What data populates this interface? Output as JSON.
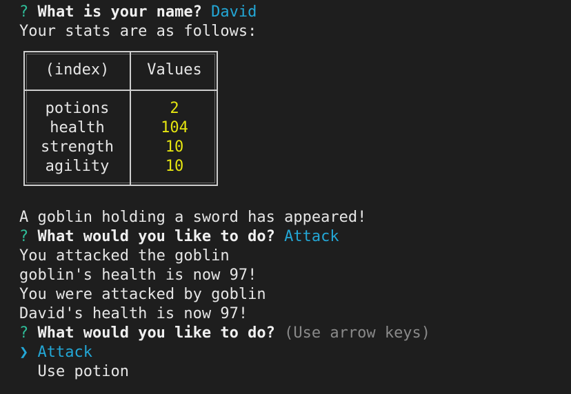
{
  "prompt_name": {
    "marker": "?",
    "question": "What is your name?",
    "answer": "David"
  },
  "stats_intro": "Your stats are as follows:",
  "stats_table": {
    "headers": [
      "(index)",
      "Values"
    ],
    "rows": [
      {
        "key": "potions",
        "value": "2"
      },
      {
        "key": "health",
        "value": "104"
      },
      {
        "key": "strength",
        "value": "10"
      },
      {
        "key": "agility",
        "value": "10"
      }
    ]
  },
  "log": {
    "goblin_appeared": "A goblin holding a sword has appeared!",
    "prompt_action_1": {
      "marker": "?",
      "question": "What would you like to do?",
      "answer": "Attack"
    },
    "attacked_goblin": "You attacked the goblin",
    "goblin_health": "goblin's health is now 97!",
    "attacked_by_goblin": "You were attacked by goblin",
    "player_health": "David's health is now 97!"
  },
  "prompt_action_2": {
    "marker": "?",
    "question": "What would you like to do?",
    "hint": "(Use arrow keys)",
    "cursor": "❯",
    "options": [
      "Attack",
      "Use potion"
    ]
  },
  "colors": {
    "background": "#1e1e1e",
    "question_marker": "#2fbf9a",
    "answer": "#23a7d6",
    "number": "#e5e510",
    "hint": "#8a8a8a"
  }
}
